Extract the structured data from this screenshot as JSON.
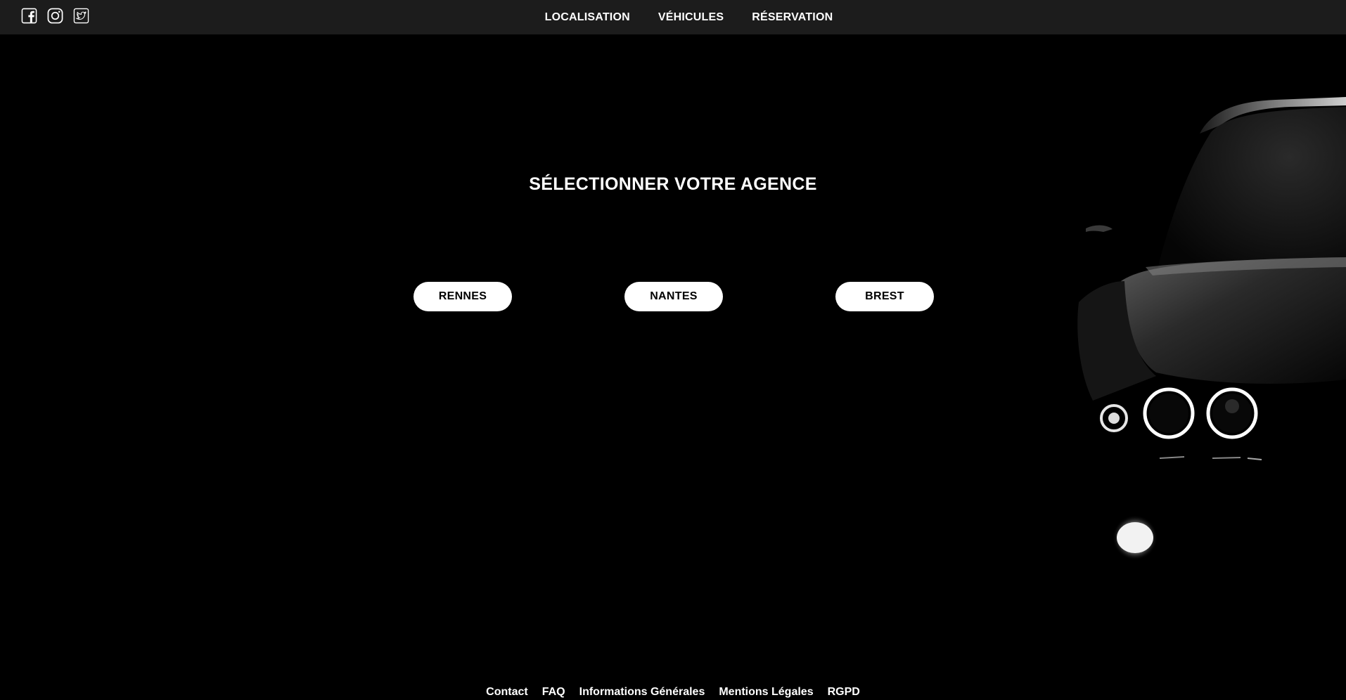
{
  "header": {
    "social": [
      {
        "icon": "facebook-icon"
      },
      {
        "icon": "instagram-icon"
      },
      {
        "icon": "twitter-icon"
      }
    ],
    "nav": [
      {
        "label": "LOCALISATION"
      },
      {
        "label": "VÉHICULES"
      },
      {
        "label": "RÉSERVATION"
      }
    ]
  },
  "main": {
    "title": "SÉLECTIONNER VOTRE AGENCE",
    "agencies": [
      {
        "label": "RENNES"
      },
      {
        "label": "NANTES"
      },
      {
        "label": "BREST"
      }
    ]
  },
  "footer": {
    "links": [
      {
        "label": "Contact"
      },
      {
        "label": "FAQ"
      },
      {
        "label": "Informations Générales"
      },
      {
        "label": "Mentions Légales"
      },
      {
        "label": "RGPD"
      }
    ]
  },
  "colors": {
    "background": "#000000",
    "topbar": "#1c1c1c",
    "button_bg": "#ffffff",
    "button_text": "#000000",
    "text": "#ffffff"
  }
}
